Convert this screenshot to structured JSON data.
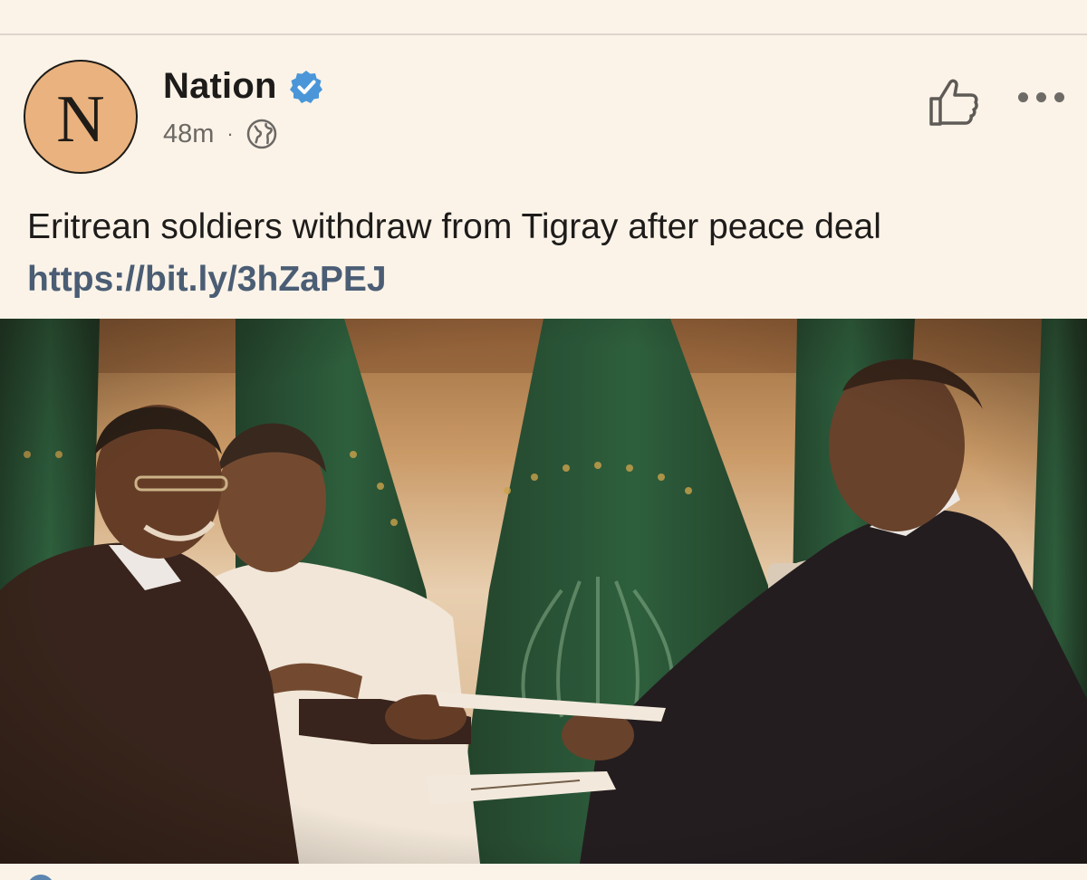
{
  "post": {
    "author": {
      "name": "Nation",
      "avatar_letter": "N",
      "verified": true
    },
    "timestamp": "48m",
    "separator": "·",
    "audience_icon": "globe-icon",
    "text": "Eritrean soldiers withdraw from Tigray after peace deal",
    "link": "https://bit.ly/3hZaPEJ",
    "actions": {
      "like_icon": "thumbs-up-icon",
      "more_icon": "more-options-icon"
    }
  },
  "colors": {
    "background": "#fbf3e8",
    "avatar": "#e9b27e",
    "verified_badge": "#4a96d8",
    "link": "#4a5d74",
    "secondary_text": "#6b6864"
  }
}
